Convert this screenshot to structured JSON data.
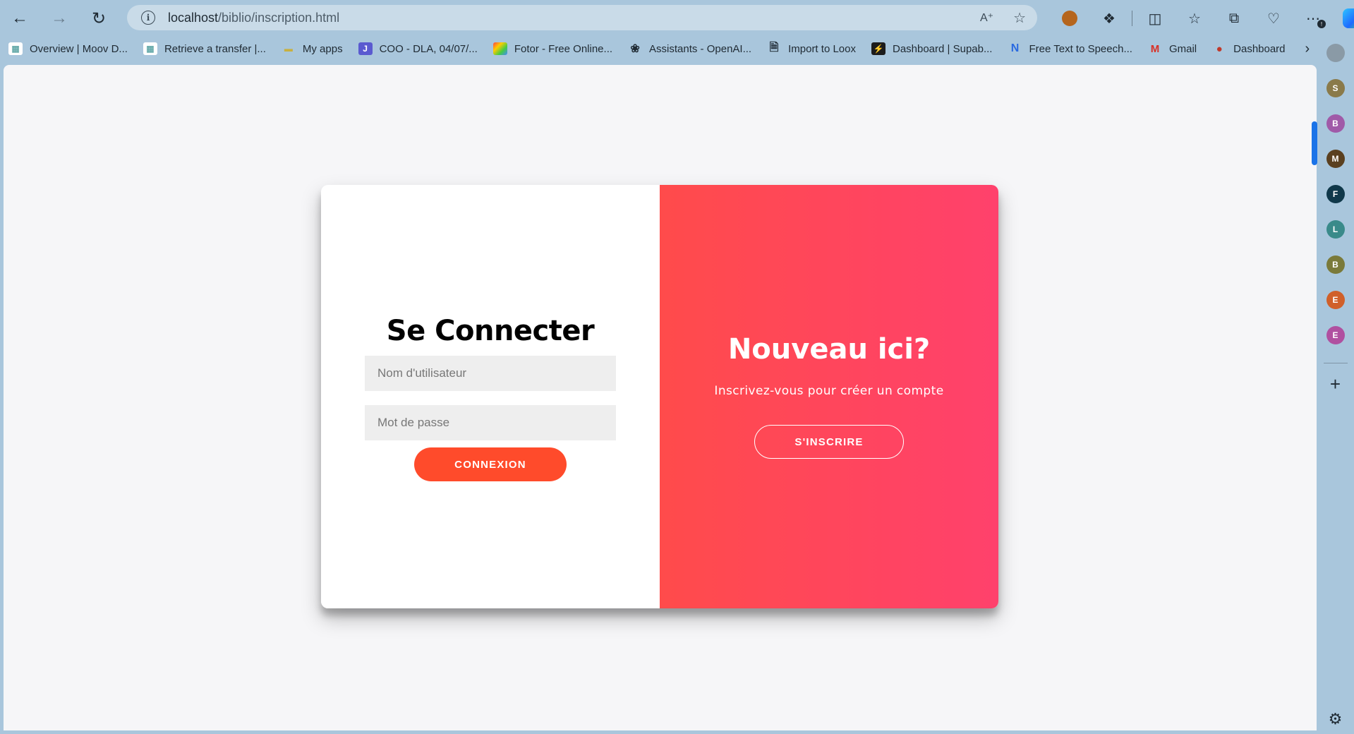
{
  "browser": {
    "url_host": "localhost",
    "url_path": "/biblio/inscription.html",
    "icons": {
      "back": "arrow-left-icon",
      "forward": "arrow-right-icon",
      "reload": "reload-icon",
      "site_info": "info-icon",
      "read_aloud": "read-aloud-icon",
      "favorite": "star-icon"
    }
  },
  "bookmarks": [
    {
      "label": "Overview | Moov D...",
      "icon": "folder-icon"
    },
    {
      "label": "Retrieve a transfer |...",
      "icon": "folder-icon"
    },
    {
      "label": "My apps",
      "icon": "apps-icon"
    },
    {
      "label": "COO - DLA, 04/07/...",
      "icon": "doc-icon"
    },
    {
      "label": "Fotor - Free Online...",
      "icon": "fotor-icon"
    },
    {
      "label": "Assistants - OpenAI...",
      "icon": "openai-icon"
    },
    {
      "label": "Import to Loox",
      "icon": "page-icon"
    },
    {
      "label": "Dashboard | Supab...",
      "icon": "supabase-icon"
    },
    {
      "label": "Free Text to Speech...",
      "icon": "n-icon"
    },
    {
      "label": "Gmail",
      "icon": "gmail-icon"
    },
    {
      "label": "Dashboard",
      "icon": "dashboard-icon"
    }
  ],
  "sidebar": {
    "profiles": [
      {
        "letter": "S",
        "color": "#8a7a4a"
      },
      {
        "letter": "B",
        "color": "#a05aa8"
      },
      {
        "letter": "M",
        "color": "#5a4020"
      },
      {
        "letter": "F",
        "color": "#10384a"
      },
      {
        "letter": "L",
        "color": "#3a8a8a"
      },
      {
        "letter": "B",
        "color": "#7a7a3a"
      },
      {
        "letter": "E",
        "color": "#d0602a"
      },
      {
        "letter": "E",
        "color": "#b050a0"
      }
    ]
  },
  "login": {
    "title": "Se Connecter",
    "username_placeholder": "Nom d'utilisateur",
    "password_placeholder": "Mot de passe",
    "submit_label": "CONNEXION"
  },
  "signup": {
    "title": "Nouveau ici?",
    "text": "Inscrivez-vous pour créer un compte",
    "button_label": "S'INSCRIRE"
  },
  "colors": {
    "accent": "#ff4b2b",
    "gradient_start": "#ff4b4b",
    "gradient_end": "#ff416c"
  }
}
